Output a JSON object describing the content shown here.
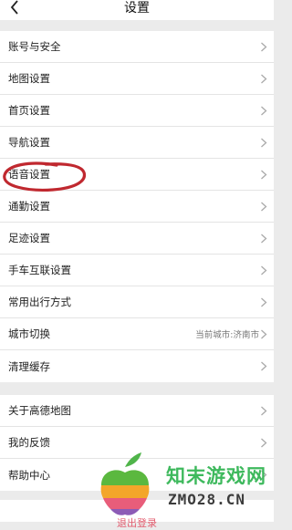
{
  "nav": {
    "title": "设置"
  },
  "groups": [
    {
      "items": [
        {
          "label": "账号与安全"
        },
        {
          "label": "地图设置"
        },
        {
          "label": "首页设置"
        },
        {
          "label": "导航设置"
        },
        {
          "label": "语音设置"
        },
        {
          "label": "通勤设置"
        },
        {
          "label": "足迹设置"
        },
        {
          "label": "手车互联设置"
        },
        {
          "label": "常用出行方式"
        },
        {
          "label": "城市切换",
          "value": "当前城市:济南市"
        },
        {
          "label": "清理缓存"
        }
      ]
    },
    {
      "items": [
        {
          "label": "关于高德地图"
        },
        {
          "label": "我的反馈"
        },
        {
          "label": "帮助中心"
        }
      ]
    }
  ],
  "footer": {
    "logout_label": "退出登录"
  },
  "watermark": {
    "name_cn": "知末游戏网",
    "domain": "ZMO28.CN"
  },
  "colors": {
    "annotation": "#c0282f",
    "logout": "#e25c6e"
  }
}
